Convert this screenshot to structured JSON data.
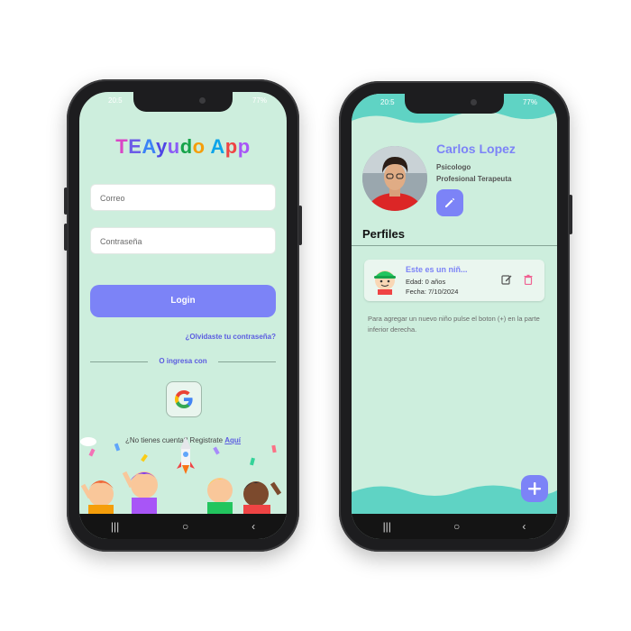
{
  "login_screen": {
    "status": {
      "time": "20:5",
      "battery": "77%"
    },
    "app_title": {
      "part1": "TEAyudo",
      "part2": "App"
    },
    "email_placeholder": "Correo",
    "password_placeholder": "Contraseña",
    "login_label": "Login",
    "forgot_label": "¿Olvidaste tu contraseña?",
    "or_label": "O ingresa con",
    "google_icon": "google-icon",
    "signup_prefix": "¿No tienes cuenta? Registrate",
    "signup_link": "Aquí",
    "nav": {
      "recent": "|||",
      "home": "○",
      "back": "‹"
    }
  },
  "profile_screen": {
    "status": {
      "time": "20:5",
      "battery": "77%"
    },
    "user_name": "Carlos Lopez",
    "role": "Psicologo",
    "sub_role": "Profesional Terapeuta",
    "section_title": "Perfiles",
    "profiles": [
      {
        "title": "Este es un niñ...",
        "age": "Edad: 0 años",
        "date": "Fecha: 7/10/2024"
      }
    ],
    "hint": "Para agregar un nuevo niño pulse el boton (+) en la parte inferior derecha.",
    "fab_label": "+",
    "nav": {
      "recent": "|||",
      "home": "○",
      "back": "‹"
    }
  },
  "colors": {
    "accent": "#7c83f7",
    "mint_background": "#cdeedd",
    "wave": "#5fd3c4",
    "delete": "#f06292"
  }
}
